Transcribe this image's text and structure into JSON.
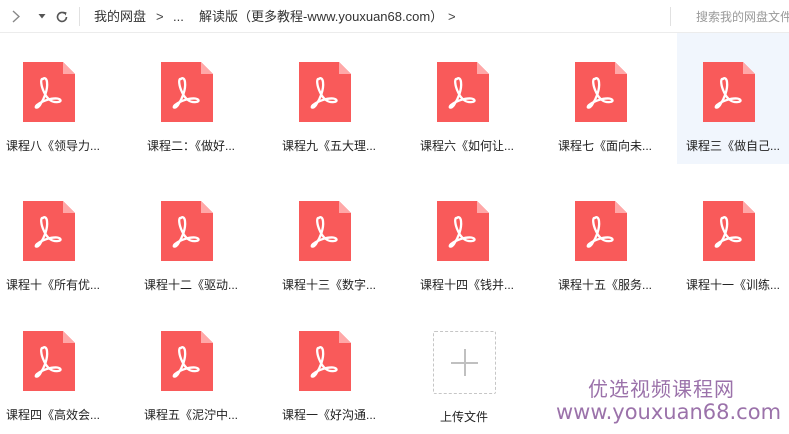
{
  "toolbar": {
    "breadcrumb": [
      {
        "label": "我的网盘"
      },
      {
        "label": "..."
      },
      {
        "label": "解读版（更多教程-www.youxuan68.com）"
      }
    ],
    "crumb_separator": ">",
    "search_placeholder": "搜索我的网盘文件"
  },
  "files": [
    {
      "name": "课程八《领导力..."
    },
    {
      "name": "课程二：《做好..."
    },
    {
      "name": "课程九《五大理..."
    },
    {
      "name": "课程六《如何让..."
    },
    {
      "name": "课程七《面向未..."
    },
    {
      "name": "课程三《做自己..."
    },
    {
      "name": "课程十《所有优..."
    },
    {
      "name": "课程十二《驱动..."
    },
    {
      "name": "课程十三《数字..."
    },
    {
      "name": "课程十四《钱并..."
    },
    {
      "name": "课程十五《服务..."
    },
    {
      "name": "课程十一《训练..."
    },
    {
      "name": "课程四《高效会..."
    },
    {
      "name": "课程五《泥泞中..."
    },
    {
      "name": "课程一《好沟通..."
    }
  ],
  "upload": {
    "label": "上传文件"
  },
  "watermark": {
    "line1": "优选视频课程网",
    "line2": "www.youxuan68.com"
  },
  "colors": {
    "pdf_icon": "#f95a5a",
    "pdf_fold": "#ffa8a8",
    "selected_bg": "#f1f6fd",
    "watermark": "#8a5a9c"
  },
  "icons": {
    "back": "chevron-right-icon",
    "dropdown": "caret-down-icon",
    "refresh": "refresh-icon",
    "file": "pdf-file-icon",
    "upload": "plus-icon"
  }
}
